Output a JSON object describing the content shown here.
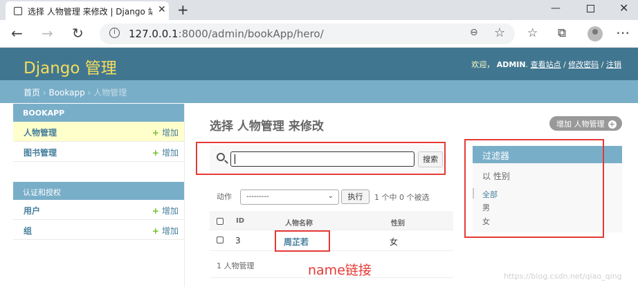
{
  "browser": {
    "tab_title": "选择 人物管理 来修改 | Django 站",
    "url_host": "127.0.0.1",
    "url_rest": ":8000/admin/bookApp/hero/"
  },
  "header": {
    "brand": "Django 管理",
    "welcome": "欢迎，",
    "username": "ADMIN",
    "view_site": "查看站点",
    "change_password": "修改密码",
    "logout": "注销"
  },
  "breadcrumbs": {
    "home": "首页",
    "app": "Bookapp",
    "current": "人物管理"
  },
  "sidebar": {
    "modules": [
      {
        "caption": "BOOKAPP",
        "items": [
          {
            "label": "人物管理",
            "add": "增加"
          },
          {
            "label": "图书管理",
            "add": "增加"
          }
        ]
      },
      {
        "caption": "认证和授权",
        "items": [
          {
            "label": "用户",
            "add": "增加"
          },
          {
            "label": "组",
            "add": "增加"
          }
        ]
      }
    ]
  },
  "main": {
    "title": "选择 人物管理 来修改",
    "add_button": "增加 人物管理",
    "search_button": "搜索",
    "search_value": "",
    "action_label": "动作",
    "action_selected": "---------",
    "action_go": "执行",
    "selection_count": "1 个中 0 个被选",
    "columns": [
      "ID",
      "人物名称",
      "性别"
    ],
    "rows": [
      {
        "id": "3",
        "name": "周芷若",
        "gender": "女"
      }
    ],
    "paginator": "1 人物管理"
  },
  "filter": {
    "title": "过滤器",
    "subtitle": "以 性别",
    "options": [
      "全部",
      "男",
      "女"
    ]
  },
  "annotation": "name链接",
  "watermark": "https://blog.csdn.net/qiao_qing",
  "colors": {
    "header_bg": "#417690",
    "brand": "#f5dd5d",
    "breadcrumb_bg": "#79aec8",
    "link": "#447e9b",
    "annotation_red": "#e53935",
    "add_green": "#70bf2b"
  }
}
